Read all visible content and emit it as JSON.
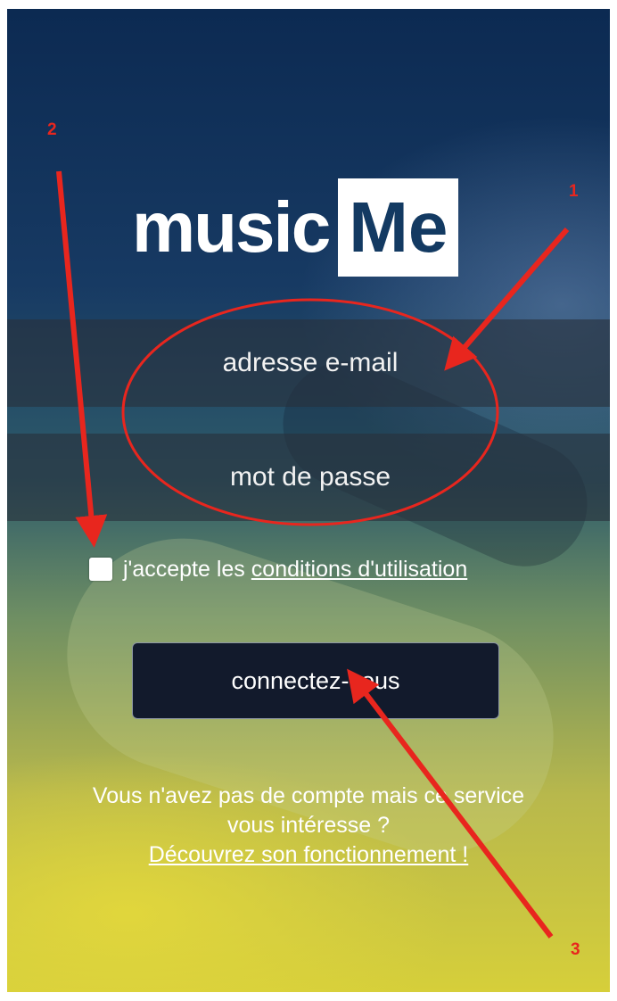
{
  "app": {
    "logo_left": "music",
    "logo_right": "Me"
  },
  "form": {
    "email_placeholder": "adresse e-mail",
    "password_placeholder": "mot de passe",
    "terms_prefix": "j'accepte les",
    "terms_link": "conditions d'utilisation",
    "checkbox_checked": false,
    "login_label": "connectez-vous"
  },
  "footer": {
    "line1": "Vous n'avez pas de compte mais ce service",
    "line2": "vous intéresse ?",
    "link": "Découvrez son fonctionnement !"
  },
  "annotations": {
    "label_1": "1",
    "label_2": "2",
    "label_3": "3",
    "color": "#e8261e"
  },
  "colors": {
    "brand_blue": "#133a62",
    "button_bg": "#121a2c"
  }
}
